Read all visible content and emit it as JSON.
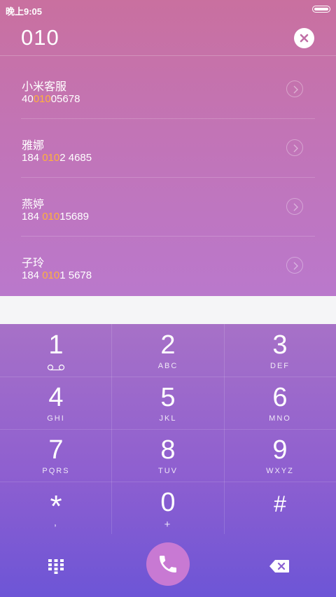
{
  "status": {
    "time": "晚上9:05"
  },
  "dial": {
    "number": "010",
    "clear_icon": "close-icon"
  },
  "contacts": [
    {
      "name": "小米客服",
      "pre": "40",
      "match": "010",
      "post": "05678"
    },
    {
      "name": "雅娜",
      "pre": "184 ",
      "match": "010",
      "post": "2 4685"
    },
    {
      "name": "燕婷",
      "pre": "184 ",
      "match": "010",
      "post": "15689"
    },
    {
      "name": "子玲",
      "pre": "184 ",
      "match": "010",
      "post": "1 5678"
    }
  ],
  "keys": [
    {
      "digit": "1",
      "letters": ""
    },
    {
      "digit": "2",
      "letters": "ABC"
    },
    {
      "digit": "3",
      "letters": "DEF"
    },
    {
      "digit": "4",
      "letters": "GHI"
    },
    {
      "digit": "5",
      "letters": "JKL"
    },
    {
      "digit": "6",
      "letters": "MNO"
    },
    {
      "digit": "7",
      "letters": "PQRS"
    },
    {
      "digit": "8",
      "letters": "TUV"
    },
    {
      "digit": "9",
      "letters": "WXYZ"
    },
    {
      "digit": "*",
      "letters": ","
    },
    {
      "digit": "0",
      "letters": "+"
    },
    {
      "digit": "#",
      "letters": ""
    }
  ],
  "bottom": {
    "left_icon": "dialpad-icon",
    "center_icon": "phone-icon",
    "right_icon": "backspace-icon"
  },
  "colors": {
    "highlight": "#ffb13b",
    "call_button": "#c879d3"
  }
}
